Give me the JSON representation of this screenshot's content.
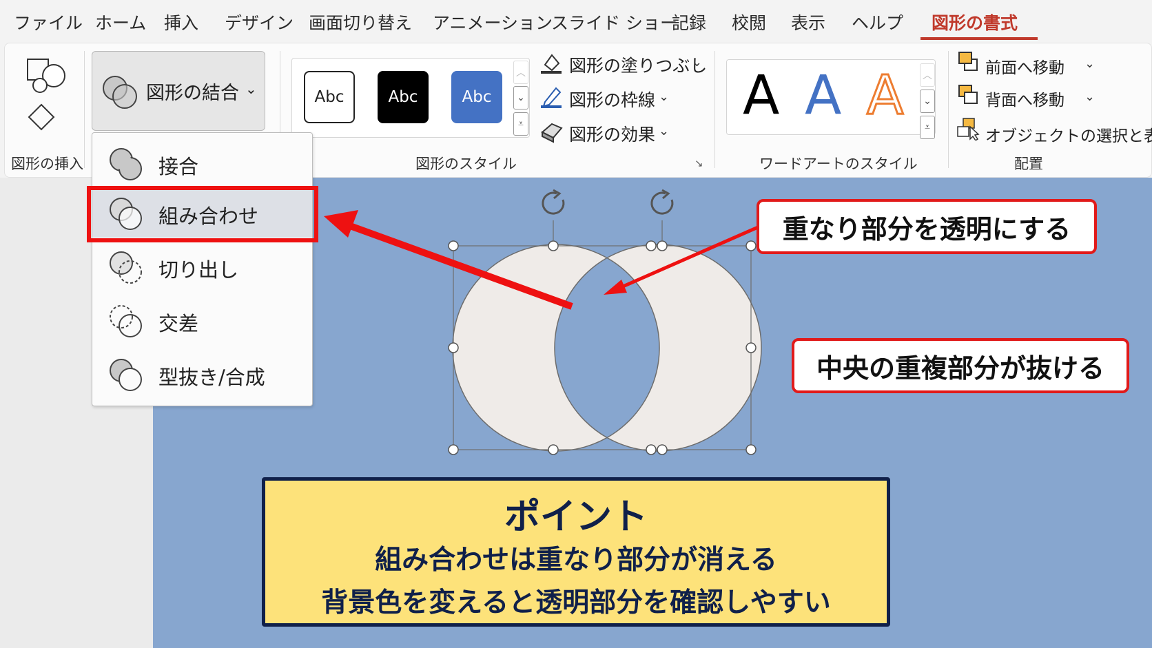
{
  "tabs": [
    {
      "label": "ファイル",
      "active": false
    },
    {
      "label": "ホーム",
      "active": false
    },
    {
      "label": "挿入",
      "active": false
    },
    {
      "label": "デザイン",
      "active": false
    },
    {
      "label": "画面切り替え",
      "active": false
    },
    {
      "label": "アニメーション",
      "active": false
    },
    {
      "label": "スライド ショー",
      "active": false
    },
    {
      "label": "記録",
      "active": false
    },
    {
      "label": "校閲",
      "active": false
    },
    {
      "label": "表示",
      "active": false
    },
    {
      "label": "ヘルプ",
      "active": false
    },
    {
      "label": "図形の書式",
      "active": true
    }
  ],
  "ribbon": {
    "insert_group_label": "図形の挿入",
    "merge_button_label": "図形の結合",
    "style_group_label": "図形のスタイル",
    "style_presets": [
      "Abc",
      "Abc",
      "Abc"
    ],
    "fill_label": "図形の塗りつぶし",
    "outline_label": "図形の枠線",
    "effect_label": "図形の効果",
    "wordart_group_label": "ワードアートのスタイル",
    "wordart_presets": [
      "A",
      "A",
      "A"
    ],
    "bring_forward_label": "前面へ移動",
    "send_backward_label": "背面へ移動",
    "selection_pane_label": "オブジェクトの選択と表示",
    "arrange_group_label": "配置"
  },
  "merge_menu": {
    "items": [
      {
        "label": "接合",
        "selected": false
      },
      {
        "label": "組み合わせ",
        "selected": true
      },
      {
        "label": "切り出し",
        "selected": false
      },
      {
        "label": "交差",
        "selected": false
      },
      {
        "label": "型抜き/合成",
        "selected": false
      }
    ]
  },
  "callouts": {
    "overlap_transparent": "重なり部分を透明にする",
    "center_removed": "中央の重複部分が抜ける"
  },
  "point": {
    "title": "ポイント",
    "line1": "組み合わせは重なり部分が消える",
    "line2": "背景色を変えると透明部分を確認しやすい"
  },
  "colors": {
    "accent_tab": "#c0392b",
    "slide_bg": "#87a6cf",
    "shape_fill": "#efebe8",
    "annotation_red": "#ee1111",
    "point_bg": "#fde27a",
    "point_border": "#10204a",
    "style_preset_1": "#ffffff",
    "style_preset_2": "#000000",
    "style_preset_3": "#4472c4",
    "wordart_1": "#000000",
    "wordart_2": "#4472c4",
    "wordart_3": "#ed7d31"
  }
}
